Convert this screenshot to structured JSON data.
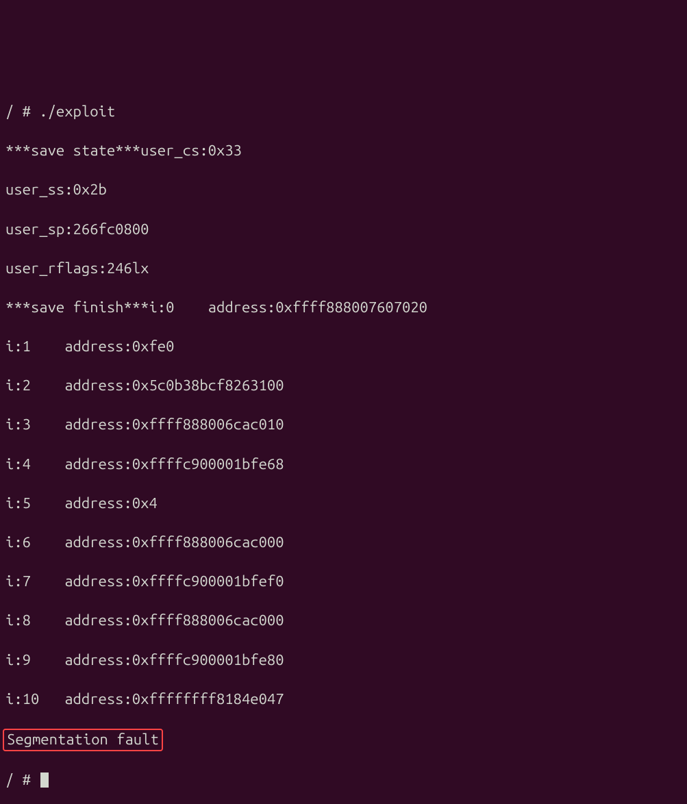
{
  "terminal": {
    "prompt1": "/ # ./exploit",
    "line1": "***save state***user_cs:0x33",
    "line2": "user_ss:0x2b",
    "line3": "user_sp:266fc0800",
    "line4": "user_rflags:246lx",
    "line5": "***save finish***i:0    address:0xffff888007607020",
    "entries": [
      {
        "i": "i:1    address:0xfe0"
      },
      {
        "i": "i:2    address:0x5c0b38bcf8263100"
      },
      {
        "i": "i:3    address:0xffff888006cac010"
      },
      {
        "i": "i:4    address:0xffffc900001bfe68"
      },
      {
        "i": "i:5    address:0x4"
      },
      {
        "i": "i:6    address:0xffff888006cac000"
      },
      {
        "i": "i:7    address:0xffffc900001bfef0"
      },
      {
        "i": "i:8    address:0xffff888006cac000"
      },
      {
        "i": "i:9    address:0xffffc900001bfe80"
      },
      {
        "i": "i:10   address:0xffffffff8184e047"
      }
    ],
    "segfault": "Segmentation fault",
    "prompt2": "/ # "
  }
}
